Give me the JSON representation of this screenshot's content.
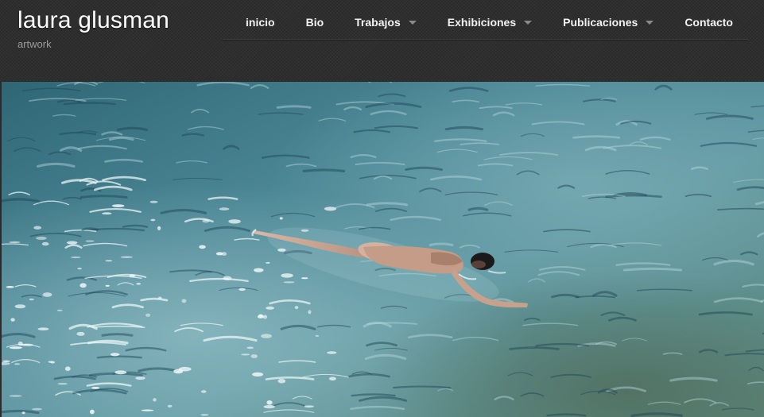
{
  "site": {
    "title": "laura glusman",
    "tagline": "artwork"
  },
  "nav": {
    "items": [
      {
        "label": "inicio",
        "has_submenu": false
      },
      {
        "label": "Bio",
        "has_submenu": false
      },
      {
        "label": "Trabajos",
        "has_submenu": true
      },
      {
        "label": "Exhibiciones",
        "has_submenu": true
      },
      {
        "label": "Publicaciones",
        "has_submenu": true
      },
      {
        "label": "Contacto",
        "has_submenu": false
      }
    ]
  },
  "hero": {
    "subject": "swimmer-in-water-photo"
  },
  "colors": {
    "header_bg": "#2e2e2e",
    "nav_text": "#f2f2f2",
    "tagline": "#9a9a9a",
    "water_light": "#6fa3ad",
    "water_dark": "#1f4c5c"
  }
}
